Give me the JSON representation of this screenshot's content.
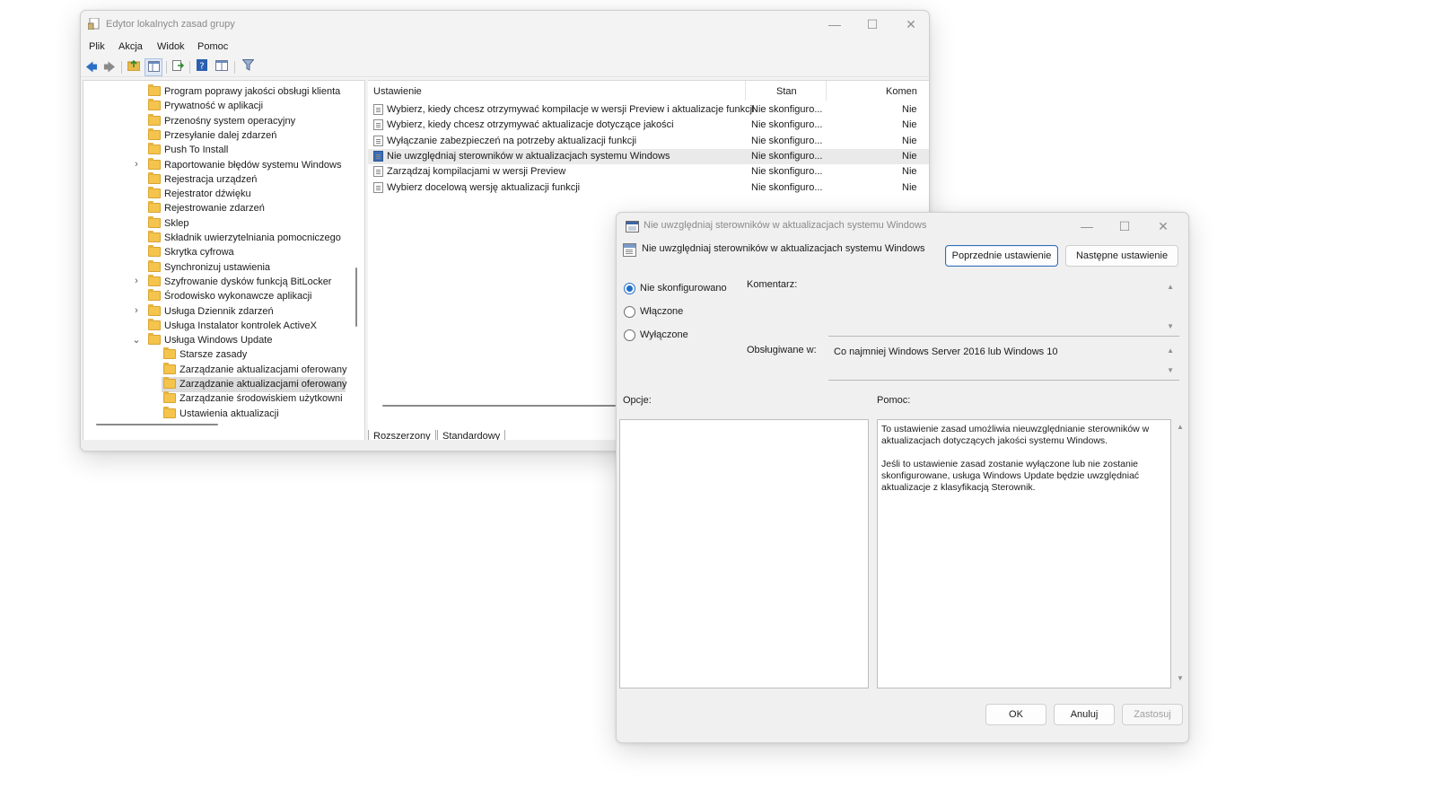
{
  "main_window": {
    "title": "Edytor lokalnych zasad grupy",
    "menu": [
      "Plik",
      "Akcja",
      "Widok",
      "Pomoc"
    ],
    "tree": [
      {
        "label": "Program poprawy jakości obsługi klienta",
        "expander": ""
      },
      {
        "label": "Prywatność w aplikacji",
        "expander": ""
      },
      {
        "label": "Przenośny system operacyjny",
        "expander": ""
      },
      {
        "label": "Przesyłanie dalej zdarzeń",
        "expander": ""
      },
      {
        "label": "Push To Install",
        "expander": ""
      },
      {
        "label": "Raportowanie błędów systemu Windows",
        "expander": "›"
      },
      {
        "label": "Rejestracja urządzeń",
        "expander": ""
      },
      {
        "label": "Rejestrator dźwięku",
        "expander": ""
      },
      {
        "label": "Rejestrowanie zdarzeń",
        "expander": ""
      },
      {
        "label": "Sklep",
        "expander": ""
      },
      {
        "label": "Składnik uwierzytelniania pomocniczego",
        "expander": ""
      },
      {
        "label": "Skrytka cyfrowa",
        "expander": ""
      },
      {
        "label": "Synchronizuj ustawienia",
        "expander": ""
      },
      {
        "label": "Szyfrowanie dysków funkcją BitLocker",
        "expander": "›"
      },
      {
        "label": "Środowisko wykonawcze aplikacji",
        "expander": ""
      },
      {
        "label": "Usługa Dziennik zdarzeń",
        "expander": "›"
      },
      {
        "label": "Usługa Instalator kontrolek ActiveX",
        "expander": ""
      },
      {
        "label": "Usługa Windows Update",
        "expander": "⌄"
      },
      {
        "label": "Starsze zasady",
        "expander": ""
      },
      {
        "label": "Zarządzanie aktualizacjami oferowany",
        "expander": ""
      },
      {
        "label": "Zarządzanie aktualizacjami oferowany",
        "expander": ""
      },
      {
        "label": "Zarządzanie środowiskiem użytkowni",
        "expander": ""
      },
      {
        "label": "Ustawienia aktualizacji",
        "expander": ""
      }
    ],
    "list_columns": [
      "Ustawienie",
      "Stan",
      "Komen"
    ],
    "list_rows": [
      {
        "name": "Wybierz, kiedy chcesz otrzymywać kompilacje w wersji Preview i aktualizacje funkcji",
        "state": "Nie skonfiguro...",
        "comment": "Nie"
      },
      {
        "name": "Wybierz, kiedy chcesz otrzymywać aktualizacje dotyczące jakości",
        "state": "Nie skonfiguro...",
        "comment": "Nie"
      },
      {
        "name": "Wyłączanie zabezpieczeń na potrzeby aktualizacji funkcji",
        "state": "Nie skonfiguro...",
        "comment": "Nie"
      },
      {
        "name": "Nie uwzględniaj sterowników w aktualizacjach systemu Windows",
        "state": "Nie skonfiguro...",
        "comment": "Nie"
      },
      {
        "name": "Zarządzaj kompilacjami w wersji Preview",
        "state": "Nie skonfiguro...",
        "comment": "Nie"
      },
      {
        "name": "Wybierz docelową wersję aktualizacji funkcji",
        "state": "Nie skonfiguro...",
        "comment": "Nie"
      }
    ],
    "tabs": [
      "Rozszerzony",
      "Standardowy"
    ]
  },
  "dialog": {
    "title": "Nie uwzględniaj sterowników w aktualizacjach systemu Windows",
    "heading": "Nie uwzględniaj sterowników w aktualizacjach systemu Windows",
    "prev_button": "Poprzednie ustawienie",
    "next_button": "Następne ustawienie",
    "radio_options": [
      "Nie skonfigurowano",
      "Włączone",
      "Wyłączone"
    ],
    "selected_option": "Nie skonfigurowano",
    "comment_label": "Komentarz:",
    "comment_value": "",
    "supported_label": "Obsługiwane w:",
    "supported_value": "Co najmniej Windows Server 2016 lub Windows 10",
    "options_label": "Opcje:",
    "help_label": "Pomoc:",
    "help_paragraph_1": "To ustawienie zasad umożliwia nieuwzględnianie sterowników w aktualizacjach dotyczących jakości systemu Windows.",
    "help_paragraph_2": "Jeśli to ustawienie zasad zostanie wyłączone lub nie zostanie skonfigurowane, usługa Windows Update będzie uwzględniać aktualizacje z klasyfikacją Sterownik.",
    "ok_button": "OK",
    "cancel_button": "Anuluj",
    "apply_button": "Zastosuj"
  },
  "colors": {
    "accent": "#1f6fc5",
    "folder": "#f4c44d"
  }
}
